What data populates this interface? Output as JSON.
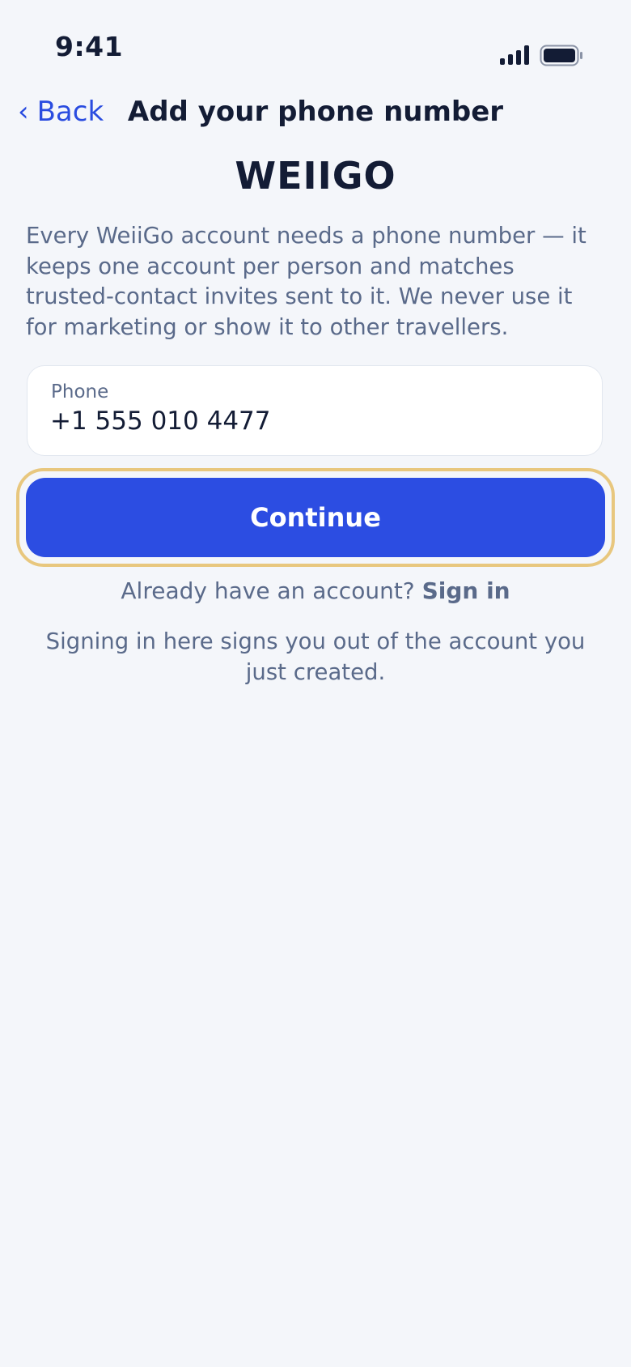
{
  "status_bar": {
    "time": "9:41",
    "signal_icon": "cellular-signal-icon",
    "battery_icon": "battery-icon"
  },
  "nav": {
    "back_label": "Back",
    "back_icon": "chevron-left-icon",
    "title": "Add your phone number"
  },
  "brand": {
    "name": "WEIIGO"
  },
  "description": "Every WeiiGo account needs a phone number — it keeps one account per person and matches trusted-contact invites sent to it. We never use it for marketing or show it to other travellers.",
  "phone_field": {
    "label": "Phone",
    "value": "+1 555 010 4477"
  },
  "continue_button": {
    "label": "Continue"
  },
  "signin": {
    "prompt": "Already have an account?",
    "link_label": "Sign in",
    "note": "Signing in here signs you out of the account you just created."
  },
  "colors": {
    "background": "#f4f6fa",
    "accent": "#2c4de2",
    "focus_ring": "#e8c77e",
    "text_primary": "#131c35",
    "text_secondary": "#5a6a8a"
  }
}
